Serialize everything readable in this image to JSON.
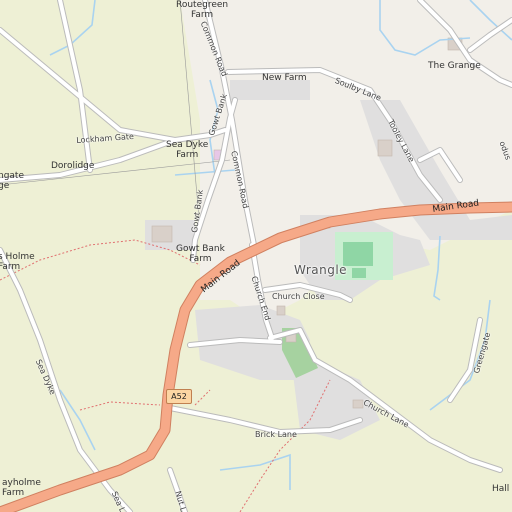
{
  "map": {
    "village": "Wrangle",
    "route_shield": "A52",
    "roads": {
      "main_road_1": "Main Road",
      "main_road_2": "Main Road",
      "common_road_1": "Common Road",
      "common_road_2": "Common Road",
      "gowt_bank": "Gowt Bank",
      "gowt_bank_2": "Gowt Bank",
      "lockham_gate": "Lockham Gate",
      "soulby_lane": "Soulby Lane",
      "tooley_lane": "Tooley Lane",
      "church_end": "Church End",
      "church_close": "Church Close",
      "church_lane": "Church Lane",
      "brick_lane": "Brick Lane",
      "sea_dyke": "Sea Dyke",
      "sea_lane": "Sea La",
      "nut_lane": "Nut L",
      "greengate": "Greengate",
      "edge_right": "odus"
    },
    "places": {
      "routegreen_farm": "Routegreen\nFarm",
      "new_farm": "New Farm",
      "the_grange": "The Grange",
      "sea_dyke_farm": "Sea Dyke\nFarm",
      "doroldge": "Dorolidge",
      "ngate_ge": "ngate\nge",
      "gowt_bank_farm": "Gowt Bank\nFarm",
      "holme_farm": "s Holme\nFarm",
      "ayholme_farm": "ayholme\nFarm",
      "hall": "Hall"
    }
  }
}
